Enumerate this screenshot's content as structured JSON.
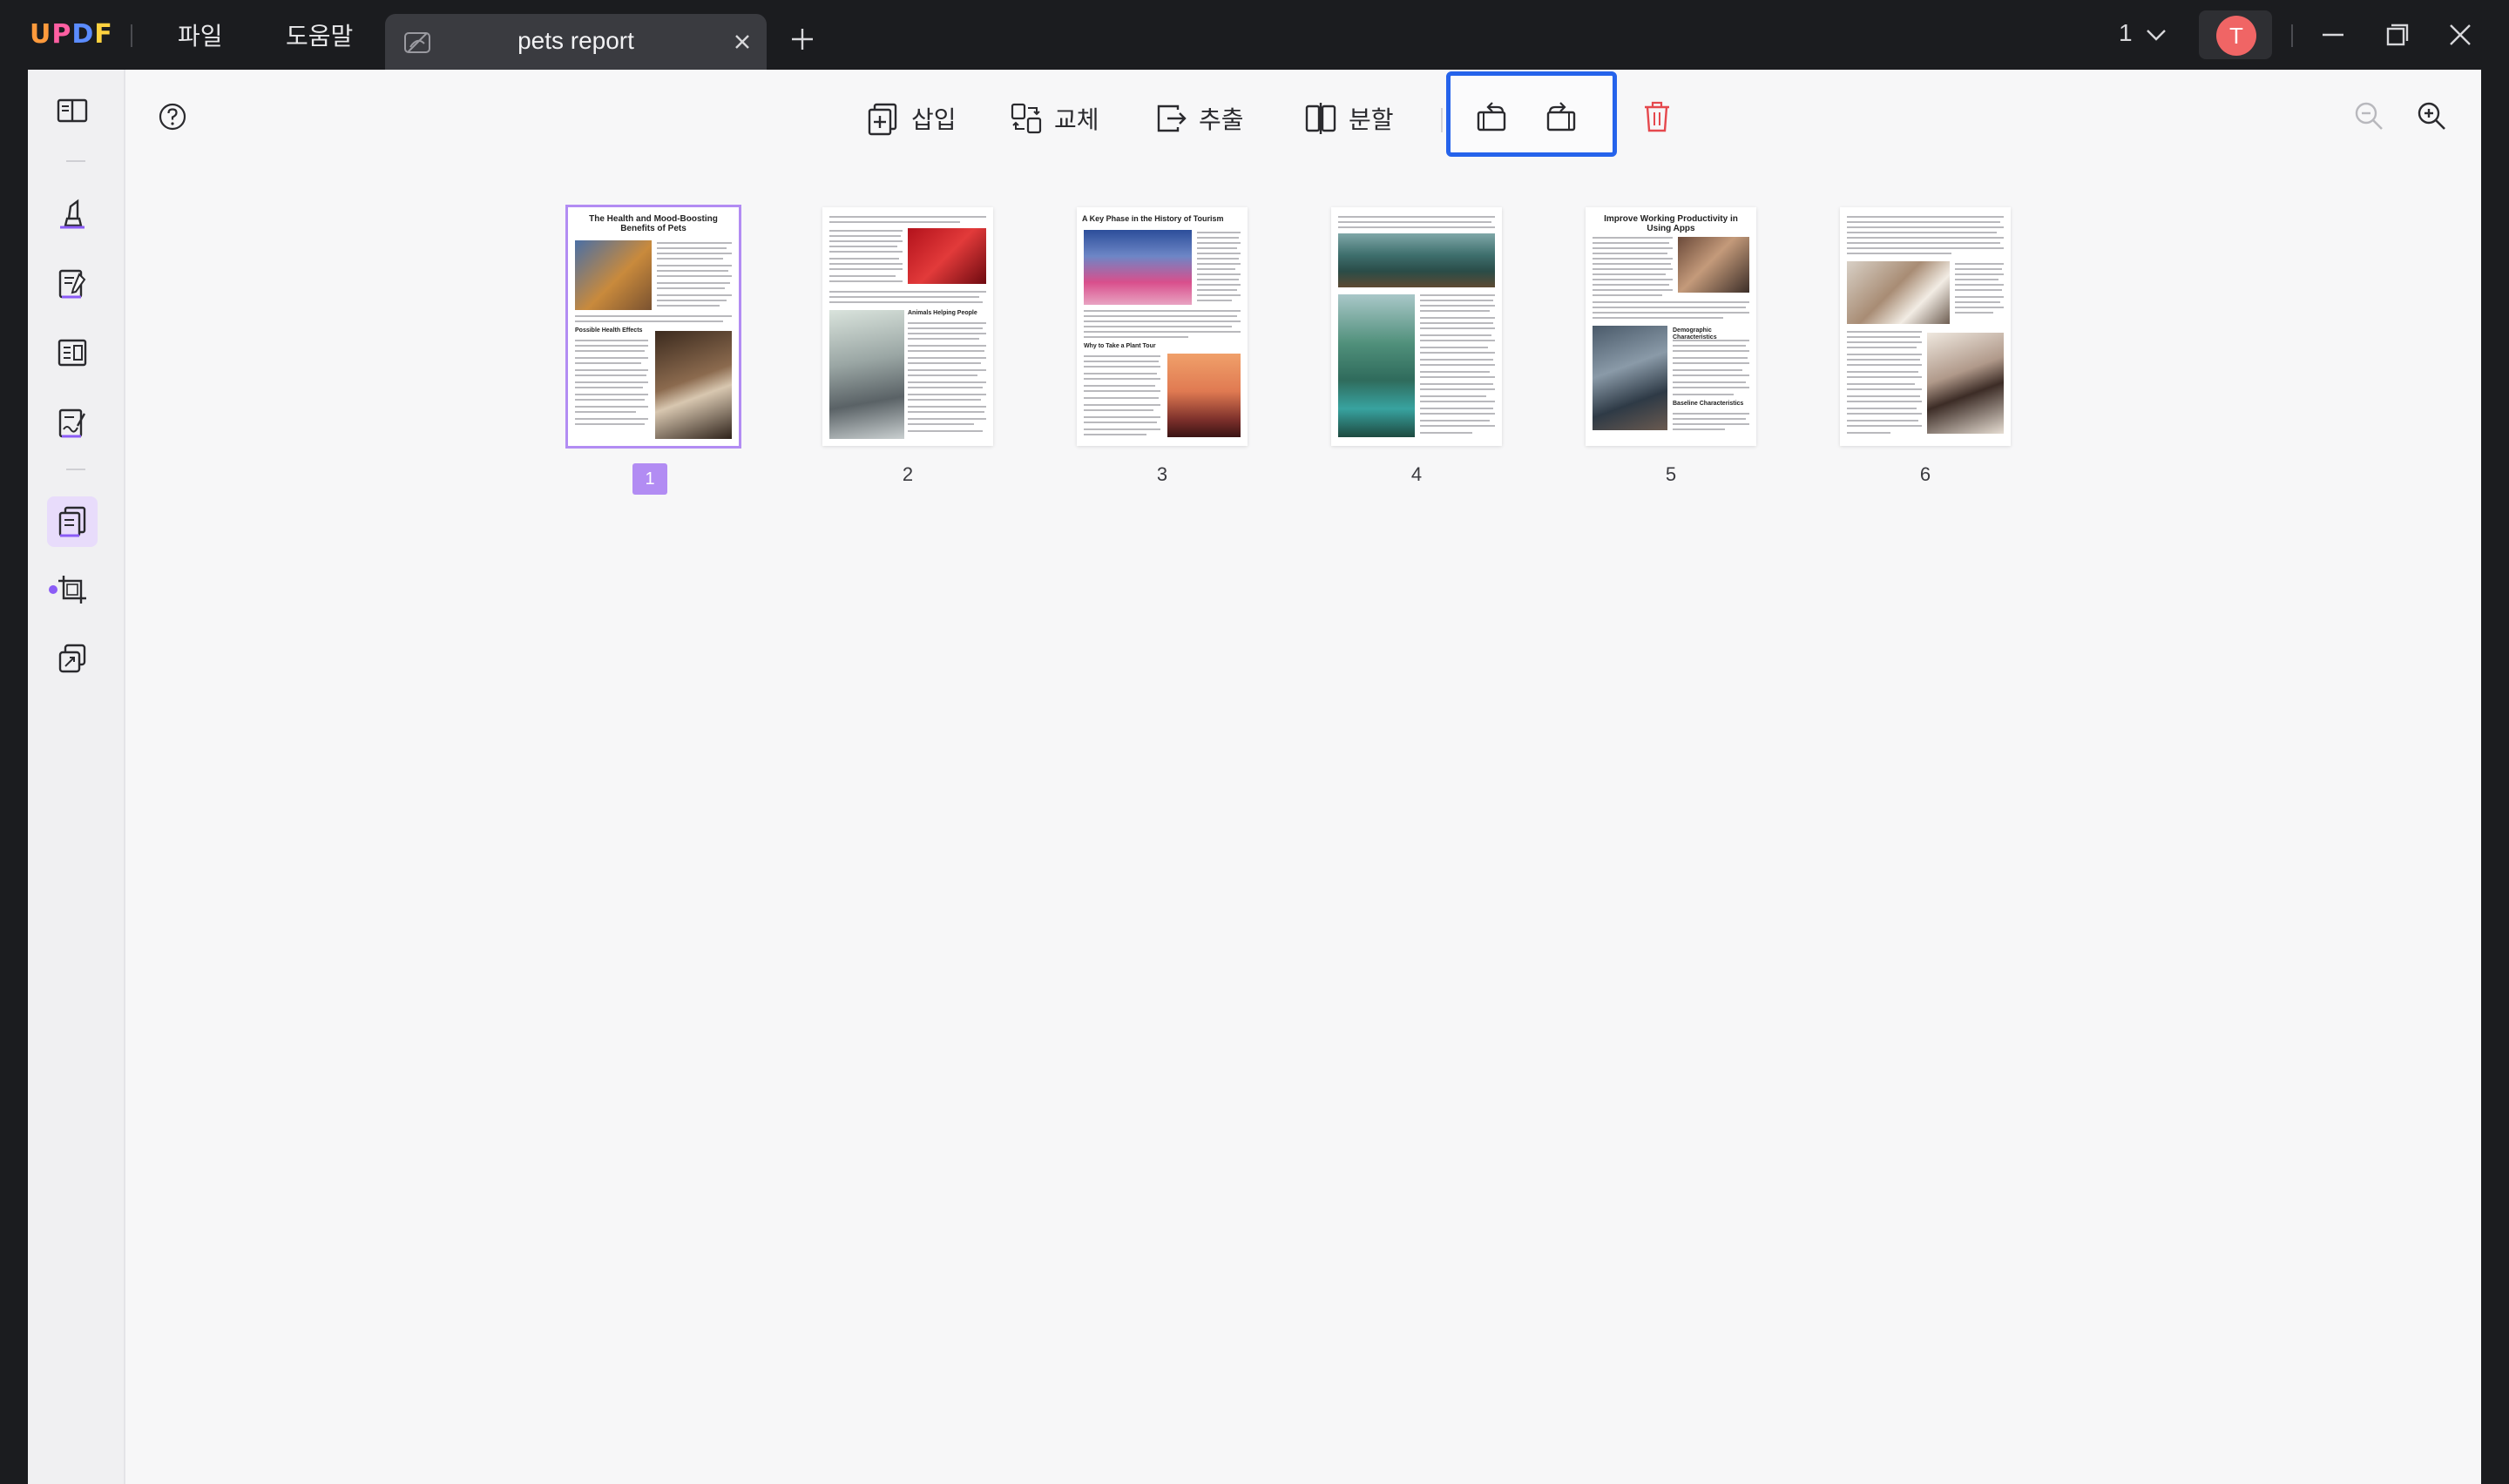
{
  "app": {
    "logo": "UPDF",
    "menu": [
      "파일",
      "도움말"
    ]
  },
  "tab": {
    "title": "pets report"
  },
  "titlebar": {
    "page_indicator": "1",
    "avatar_initial": "T"
  },
  "toolbar": {
    "insert_label": "삽입",
    "replace_label": "교체",
    "extract_label": "추출",
    "split_label": "분할"
  },
  "pages": [
    {
      "number": "1",
      "selected": true,
      "title": "The Health and Mood-Boosting Benefits of Pets",
      "subheading": "Possible Health Effects"
    },
    {
      "number": "2",
      "selected": false,
      "subheading": "Animals Helping People"
    },
    {
      "number": "3",
      "selected": false,
      "title": "A Key Phase in the History of Tourism",
      "subheading": "Why to Take a Plant Tour"
    },
    {
      "number": "4",
      "selected": false
    },
    {
      "number": "5",
      "selected": false,
      "title": "Improve Working Productivity in Using Apps",
      "subheading": "Demographic Characteristics",
      "subheading2": "Baseline Characteristics"
    },
    {
      "number": "6",
      "selected": false
    }
  ],
  "colors": {
    "accent_purple": "#b28cf3",
    "rotate_highlight": "#2563eb",
    "delete_red": "#e5484d",
    "avatar": "#f06565"
  }
}
